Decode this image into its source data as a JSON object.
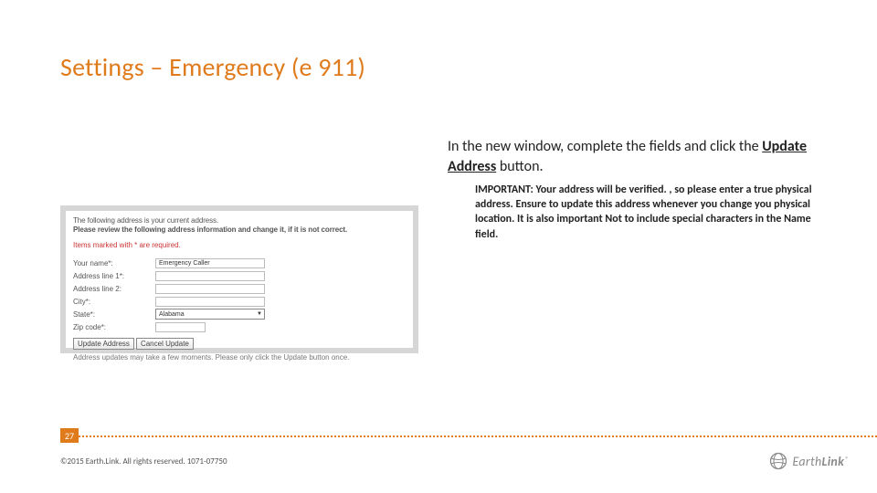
{
  "title": "Settings – Emergency (e 911)",
  "instruction": {
    "pre": "In the new window, complete the fields and click the ",
    "button_name": "Update Address",
    "post": " button."
  },
  "important_note": "IMPORTANT: Your address will be verified. , so please enter a true physical address. Ensure to update this address whenever you change you physical location. It is also important Not to include special characters in the Name field.",
  "form": {
    "intro1": "The following address is your current address.",
    "intro2": "Please review the following address information and change it, if it is not correct.",
    "required_note": "Items marked with * are required.",
    "labels": {
      "name": "Your name*:",
      "addr1": "Address line 1*:",
      "addr2": "Address line 2:",
      "city": "City*:",
      "state": "State*:",
      "zip": "Zip code*:"
    },
    "name_value": "Emergency Caller",
    "state_value": "Alabama",
    "buttons": {
      "update": "Update Address",
      "cancel": "Cancel Update"
    },
    "footer": "Address updates may take a few moments. Please only click the Update button once."
  },
  "page_number": "27",
  "copyright": "©2015 Earth.Link. All rights reserved. 1071-07750",
  "logo": {
    "part1": "Earth",
    "part2": "Link",
    "tm": "®"
  }
}
